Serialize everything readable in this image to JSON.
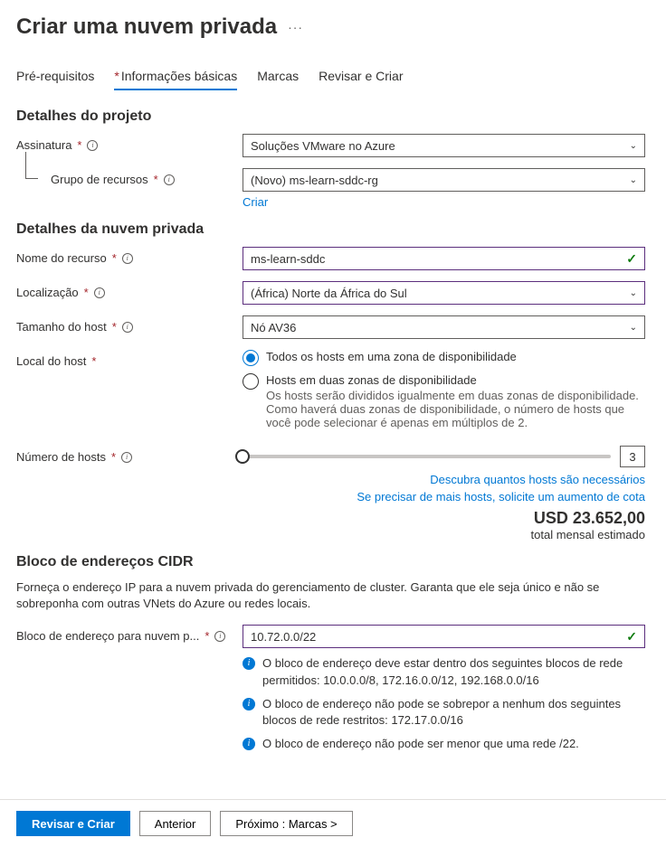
{
  "page_title": "Criar uma nuvem privada",
  "tabs": {
    "prereq": "Pré-requisitos",
    "basics": "Informações básicas",
    "tags": "Marcas",
    "review": "Revisar e Criar"
  },
  "sections": {
    "project": "Detalhes do projeto",
    "cloud": "Detalhes da nuvem privada",
    "cidr": "Bloco de endereços CIDR"
  },
  "labels": {
    "subscription": "Assinatura",
    "resource_group": "Grupo de recursos",
    "resource_name": "Nome do recurso",
    "location": "Localização",
    "host_size": "Tamanho do host",
    "host_location": "Local do host",
    "host_count": "Número de hosts",
    "cidr_block": "Bloco de endereço para nuvem p..."
  },
  "values": {
    "subscription": "Soluções VMware no Azure",
    "resource_group": "(Novo) ms-learn-sddc-rg",
    "resource_name": "ms-learn-sddc",
    "location": "(África) Norte da África do Sul",
    "host_size": "Nó AV36",
    "host_count": "3",
    "cidr_block": "10.72.0.0/22"
  },
  "links": {
    "create_rg": "Criar",
    "discover_hosts": "Descubra quantos hosts são necessários",
    "quota_increase": "Se precisar de mais hosts, solicite um aumento de cota"
  },
  "radio": {
    "single_zone": "Todos os hosts em uma zona de disponibilidade",
    "two_zones": "Hosts em duas zonas de disponibilidade",
    "two_zones_desc": "Os hosts serão divididos igualmente em duas zonas de disponibilidade. Como haverá duas zonas de disponibilidade, o número de hosts que você pode selecionar é apenas em múltiplos de 2."
  },
  "price": {
    "amount": "USD 23.652,00",
    "desc": "total mensal estimado"
  },
  "cidr_desc": "Forneça o endereço IP para a nuvem privada do gerenciamento de cluster. Garanta que ele seja único e não se sobreponha com outras VNets do Azure ou redes locais.",
  "cidr_info": {
    "msg1": "O bloco de endereço deve estar dentro dos seguintes blocos de rede permitidos: 10.0.0.0/8, 172.16.0.0/12, 192.168.0.0/16",
    "msg2": "O bloco de endereço não pode se sobrepor a nenhum dos seguintes blocos de rede restritos: 172.17.0.0/16",
    "msg3": "O bloco de endereço não pode ser menor que uma rede /22."
  },
  "footer": {
    "review": "Revisar e Criar",
    "previous": "Anterior",
    "next": "Próximo : Marcas >"
  }
}
